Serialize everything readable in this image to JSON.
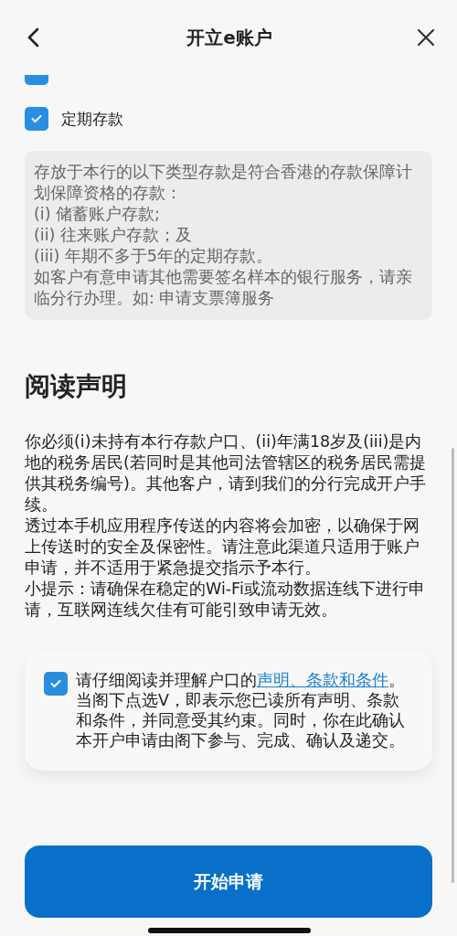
{
  "header": {
    "title": "开立e账户"
  },
  "options": [
    {
      "checked": true,
      "cut": true
    },
    {
      "label": "定期存款",
      "checked": true,
      "cut": false
    }
  ],
  "notice": [
    "存放于本行的以下类型存款是符合香港的存款保障计划保障资格的存款：",
    "(i) 储蓄账户存款;",
    "(ii) 往来账户存款；及",
    "(iii) 年期不多于5年的定期存款。",
    "如客户有意申请其他需要签名样本的银行服务，请亲临分行办理。如: 申请支票簿服务"
  ],
  "statement": {
    "heading": "阅读声明",
    "paragraphs": [
      "你必须(i)未持有本行存款户口、(ii)年满18岁及(iii)是内地的税务居民(若同时是其他司法管辖区的税务居民需提供其税务编号)。其他客户，请到我们的分行完成开户手续。",
      "透过本手机应用程序传送的内容将会加密，以确保于网上传送时的安全及保密性。请注意此渠道只适用于账户申请，并不适用于紧急提交指示予本行。",
      "小提示：请确保在稳定的Wi-Fi或流动数据连线下进行申请，互联网连线欠佳有可能引致申请无效。"
    ]
  },
  "agreement": {
    "checked": true,
    "before": "请仔细阅读并理解户口的",
    "link": "声明、条款和条件",
    "after": "。当阁下点选V，即表示您已读所有声明、条款和条件，并同意受其约束。同时，你在此确认本开户申请由阁下参与、完成、确认及递交。"
  },
  "button": {
    "label": "开始申请"
  }
}
